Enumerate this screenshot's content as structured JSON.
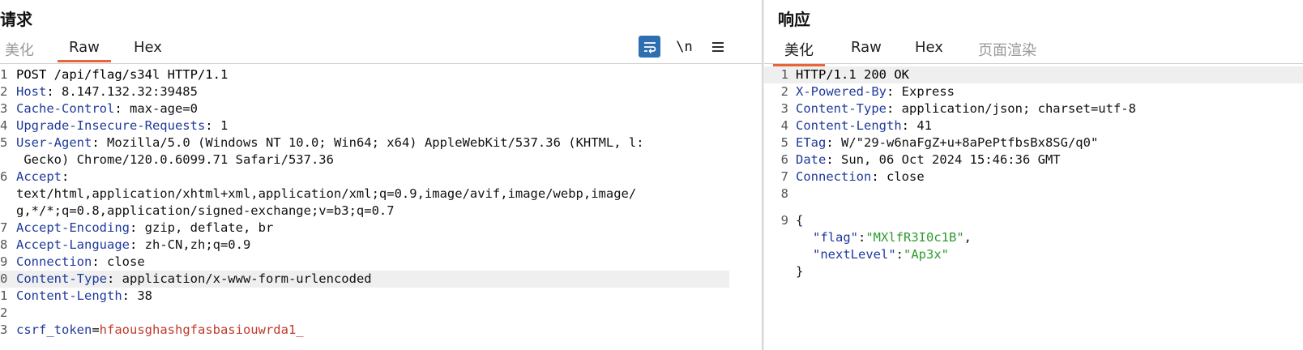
{
  "request": {
    "title": "请求",
    "tabs": [
      {
        "label": "美化",
        "active": false
      },
      {
        "label": "Raw",
        "active": true
      },
      {
        "label": "Hex",
        "active": false
      }
    ],
    "tools": {
      "wrap_icon": "wrap-icon",
      "newline_label": "\\n",
      "menu_icon": "menu-icon"
    },
    "request_line": "POST /api/flag/s34l HTTP/1.1",
    "line_numbers": [
      "1",
      "2",
      "3",
      "4",
      "5",
      "",
      "6",
      "",
      "",
      "7",
      "8",
      "9",
      "0",
      "1",
      "2",
      "3"
    ],
    "headers": [
      {
        "name": "Host",
        "value": " 8.147.132.32:39485"
      },
      {
        "name": "Cache-Control",
        "value": " max-age=0"
      },
      {
        "name": "Upgrade-Insecure-Requests",
        "value": " 1"
      },
      {
        "name": "User-Agent",
        "value": " Mozilla/5.0 (Windows NT 10.0; Win64; x64) AppleWebKit/537.36 (KHTML, l:",
        "cont": " Gecko) Chrome/120.0.6099.71 Safari/537.36"
      },
      {
        "name": "Accept",
        "value": "",
        "cont1": "text/html,application/xhtml+xml,application/xml;q=0.9,image/avif,image/webp,image/",
        "cont2": "g,*/*;q=0.8,application/signed-exchange;v=b3;q=0.7"
      },
      {
        "name": "Accept-Encoding",
        "value": " gzip, deflate, br"
      },
      {
        "name": "Accept-Language",
        "value": " zh-CN,zh;q=0.9"
      },
      {
        "name": "Connection",
        "value": " close"
      },
      {
        "name": "Content-Type",
        "value": " application/x-www-form-urlencoded"
      },
      {
        "name": "Content-Length",
        "value": " 38"
      }
    ],
    "body": {
      "param_name": "csrf_token",
      "equals": "=",
      "param_value": "hfaousghashgfasbasiouwrda1_"
    }
  },
  "response": {
    "title": "响应",
    "tabs": [
      {
        "label": "美化",
        "active": true
      },
      {
        "label": "Raw",
        "active": false
      },
      {
        "label": "Hex",
        "active": false
      },
      {
        "label": "页面渲染",
        "active": false
      }
    ],
    "status_line": "HTTP/1.1 200 OK",
    "line_numbers": [
      "1",
      "2",
      "3",
      "4",
      "5",
      "6",
      "7",
      "8",
      "9"
    ],
    "headers": [
      {
        "name": "X-Powered-By",
        "value": " Express"
      },
      {
        "name": "Content-Type",
        "value": " application/json; charset=utf-8"
      },
      {
        "name": "Content-Length",
        "value": " 41"
      },
      {
        "name": "ETag",
        "value": " W/\"29-w6naFgZ+u+8aPePtfbsBx8SG/q0\""
      },
      {
        "name": "Date",
        "value": " Sun, 06 Oct 2024 15:46:36 GMT"
      },
      {
        "name": "Connection",
        "value": " close"
      }
    ],
    "json": {
      "open": "{",
      "close": "}",
      "flag_key": "\"flag\"",
      "flag_value": "\"MXlfR3I0c1B\"",
      "next_key": "\"nextLevel\"",
      "next_value": "\"Ap3x\"",
      "colon": ":",
      "comma": ","
    }
  }
}
